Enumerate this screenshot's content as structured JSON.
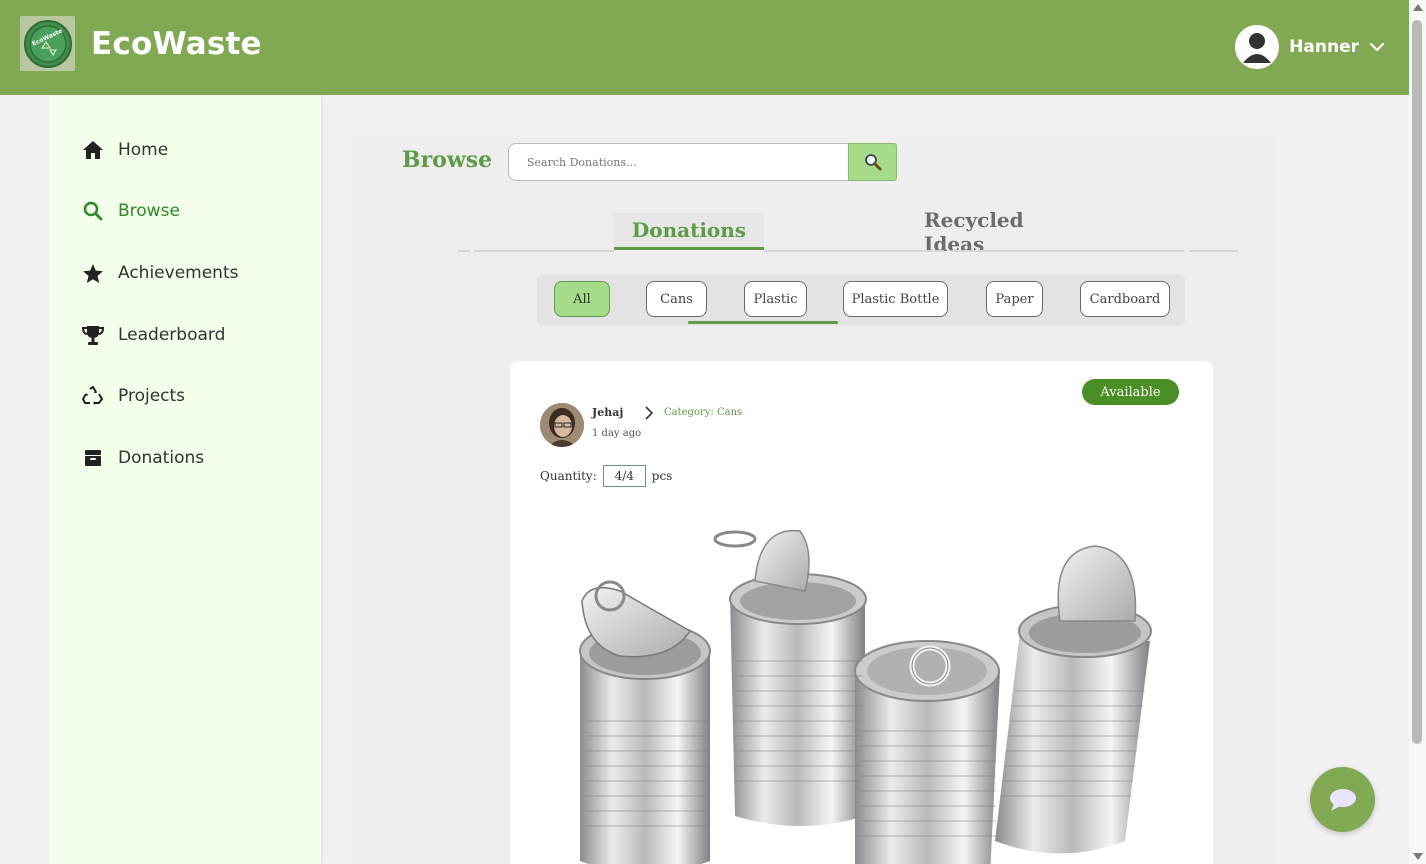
{
  "header": {
    "app_title": "EcoWaste",
    "logo_text": "EcoWaste",
    "user_name": "Hanner",
    "brand_color": "#81a954"
  },
  "sidebar": {
    "items": [
      {
        "label": "Home",
        "icon": "home-icon",
        "active": false
      },
      {
        "label": "Browse",
        "icon": "search-icon",
        "active": true
      },
      {
        "label": "Achievements",
        "icon": "star-icon",
        "active": false
      },
      {
        "label": "Leaderboard",
        "icon": "trophy-icon",
        "active": false
      },
      {
        "label": "Projects",
        "icon": "recycle-icon",
        "active": false
      },
      {
        "label": "Donations",
        "icon": "box-icon",
        "active": false
      }
    ],
    "active_color": "#2d8a2d"
  },
  "browse": {
    "title": "Browse",
    "search_placeholder": "Search Donations..."
  },
  "tabs": {
    "donations": "Donations",
    "recycled_ideas": "Recycled Ideas",
    "active": "donations"
  },
  "filters": {
    "chips": [
      "All",
      "Cans",
      "Plastic",
      "Plastic Bottle",
      "Paper",
      "Cardboard"
    ],
    "active": "All"
  },
  "card": {
    "status": "Available",
    "donor_name": "Jehaj",
    "posted": "1 day ago",
    "category": "Category: Cans",
    "quantity_label": "Quantity:",
    "quantity_value": "4/4",
    "quantity_unit": "pcs",
    "status_color": "#4a8e26"
  }
}
